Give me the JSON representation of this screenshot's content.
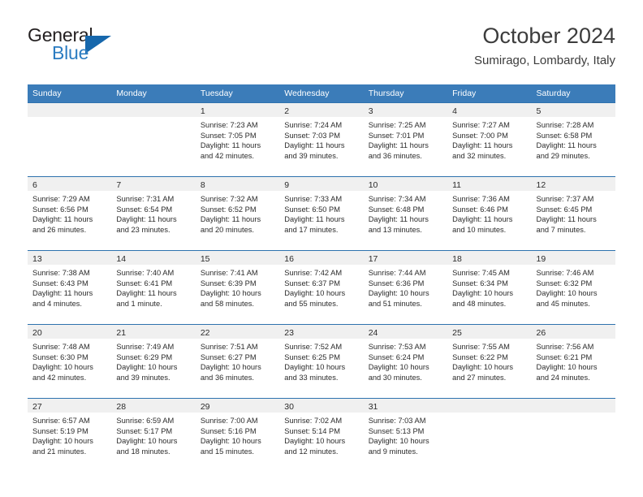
{
  "brand": {
    "word_one": "General",
    "word_two": "Blue",
    "triangle_icon": "brand-triangle-icon",
    "accent_color": "#2b7cc1",
    "triangle_color": "#1667ac"
  },
  "header": {
    "title": "October 2024",
    "subtitle": "Sumirago, Lombardy, Italy"
  },
  "theme": {
    "header_blue": "#3b7cb9",
    "row_rule_blue": "#2e72ae",
    "daynum_band": "#f0f0f0",
    "text": "#2b2b2b"
  },
  "weekday_headers": [
    "Sunday",
    "Monday",
    "Tuesday",
    "Wednesday",
    "Thursday",
    "Friday",
    "Saturday"
  ],
  "weeks": [
    [
      {
        "day": "",
        "lines": []
      },
      {
        "day": "",
        "lines": []
      },
      {
        "day": "1",
        "lines": [
          "Sunrise: 7:23 AM",
          "Sunset: 7:05 PM",
          "Daylight: 11 hours",
          "and 42 minutes."
        ]
      },
      {
        "day": "2",
        "lines": [
          "Sunrise: 7:24 AM",
          "Sunset: 7:03 PM",
          "Daylight: 11 hours",
          "and 39 minutes."
        ]
      },
      {
        "day": "3",
        "lines": [
          "Sunrise: 7:25 AM",
          "Sunset: 7:01 PM",
          "Daylight: 11 hours",
          "and 36 minutes."
        ]
      },
      {
        "day": "4",
        "lines": [
          "Sunrise: 7:27 AM",
          "Sunset: 7:00 PM",
          "Daylight: 11 hours",
          "and 32 minutes."
        ]
      },
      {
        "day": "5",
        "lines": [
          "Sunrise: 7:28 AM",
          "Sunset: 6:58 PM",
          "Daylight: 11 hours",
          "and 29 minutes."
        ]
      }
    ],
    [
      {
        "day": "6",
        "lines": [
          "Sunrise: 7:29 AM",
          "Sunset: 6:56 PM",
          "Daylight: 11 hours",
          "and 26 minutes."
        ]
      },
      {
        "day": "7",
        "lines": [
          "Sunrise: 7:31 AM",
          "Sunset: 6:54 PM",
          "Daylight: 11 hours",
          "and 23 minutes."
        ]
      },
      {
        "day": "8",
        "lines": [
          "Sunrise: 7:32 AM",
          "Sunset: 6:52 PM",
          "Daylight: 11 hours",
          "and 20 minutes."
        ]
      },
      {
        "day": "9",
        "lines": [
          "Sunrise: 7:33 AM",
          "Sunset: 6:50 PM",
          "Daylight: 11 hours",
          "and 17 minutes."
        ]
      },
      {
        "day": "10",
        "lines": [
          "Sunrise: 7:34 AM",
          "Sunset: 6:48 PM",
          "Daylight: 11 hours",
          "and 13 minutes."
        ]
      },
      {
        "day": "11",
        "lines": [
          "Sunrise: 7:36 AM",
          "Sunset: 6:46 PM",
          "Daylight: 11 hours",
          "and 10 minutes."
        ]
      },
      {
        "day": "12",
        "lines": [
          "Sunrise: 7:37 AM",
          "Sunset: 6:45 PM",
          "Daylight: 11 hours",
          "and 7 minutes."
        ]
      }
    ],
    [
      {
        "day": "13",
        "lines": [
          "Sunrise: 7:38 AM",
          "Sunset: 6:43 PM",
          "Daylight: 11 hours",
          "and 4 minutes."
        ]
      },
      {
        "day": "14",
        "lines": [
          "Sunrise: 7:40 AM",
          "Sunset: 6:41 PM",
          "Daylight: 11 hours",
          "and 1 minute."
        ]
      },
      {
        "day": "15",
        "lines": [
          "Sunrise: 7:41 AM",
          "Sunset: 6:39 PM",
          "Daylight: 10 hours",
          "and 58 minutes."
        ]
      },
      {
        "day": "16",
        "lines": [
          "Sunrise: 7:42 AM",
          "Sunset: 6:37 PM",
          "Daylight: 10 hours",
          "and 55 minutes."
        ]
      },
      {
        "day": "17",
        "lines": [
          "Sunrise: 7:44 AM",
          "Sunset: 6:36 PM",
          "Daylight: 10 hours",
          "and 51 minutes."
        ]
      },
      {
        "day": "18",
        "lines": [
          "Sunrise: 7:45 AM",
          "Sunset: 6:34 PM",
          "Daylight: 10 hours",
          "and 48 minutes."
        ]
      },
      {
        "day": "19",
        "lines": [
          "Sunrise: 7:46 AM",
          "Sunset: 6:32 PM",
          "Daylight: 10 hours",
          "and 45 minutes."
        ]
      }
    ],
    [
      {
        "day": "20",
        "lines": [
          "Sunrise: 7:48 AM",
          "Sunset: 6:30 PM",
          "Daylight: 10 hours",
          "and 42 minutes."
        ]
      },
      {
        "day": "21",
        "lines": [
          "Sunrise: 7:49 AM",
          "Sunset: 6:29 PM",
          "Daylight: 10 hours",
          "and 39 minutes."
        ]
      },
      {
        "day": "22",
        "lines": [
          "Sunrise: 7:51 AM",
          "Sunset: 6:27 PM",
          "Daylight: 10 hours",
          "and 36 minutes."
        ]
      },
      {
        "day": "23",
        "lines": [
          "Sunrise: 7:52 AM",
          "Sunset: 6:25 PM",
          "Daylight: 10 hours",
          "and 33 minutes."
        ]
      },
      {
        "day": "24",
        "lines": [
          "Sunrise: 7:53 AM",
          "Sunset: 6:24 PM",
          "Daylight: 10 hours",
          "and 30 minutes."
        ]
      },
      {
        "day": "25",
        "lines": [
          "Sunrise: 7:55 AM",
          "Sunset: 6:22 PM",
          "Daylight: 10 hours",
          "and 27 minutes."
        ]
      },
      {
        "day": "26",
        "lines": [
          "Sunrise: 7:56 AM",
          "Sunset: 6:21 PM",
          "Daylight: 10 hours",
          "and 24 minutes."
        ]
      }
    ],
    [
      {
        "day": "27",
        "lines": [
          "Sunrise: 6:57 AM",
          "Sunset: 5:19 PM",
          "Daylight: 10 hours",
          "and 21 minutes."
        ]
      },
      {
        "day": "28",
        "lines": [
          "Sunrise: 6:59 AM",
          "Sunset: 5:17 PM",
          "Daylight: 10 hours",
          "and 18 minutes."
        ]
      },
      {
        "day": "29",
        "lines": [
          "Sunrise: 7:00 AM",
          "Sunset: 5:16 PM",
          "Daylight: 10 hours",
          "and 15 minutes."
        ]
      },
      {
        "day": "30",
        "lines": [
          "Sunrise: 7:02 AM",
          "Sunset: 5:14 PM",
          "Daylight: 10 hours",
          "and 12 minutes."
        ]
      },
      {
        "day": "31",
        "lines": [
          "Sunrise: 7:03 AM",
          "Sunset: 5:13 PM",
          "Daylight: 10 hours",
          "and 9 minutes."
        ]
      },
      {
        "day": "",
        "lines": []
      },
      {
        "day": "",
        "lines": []
      }
    ]
  ]
}
